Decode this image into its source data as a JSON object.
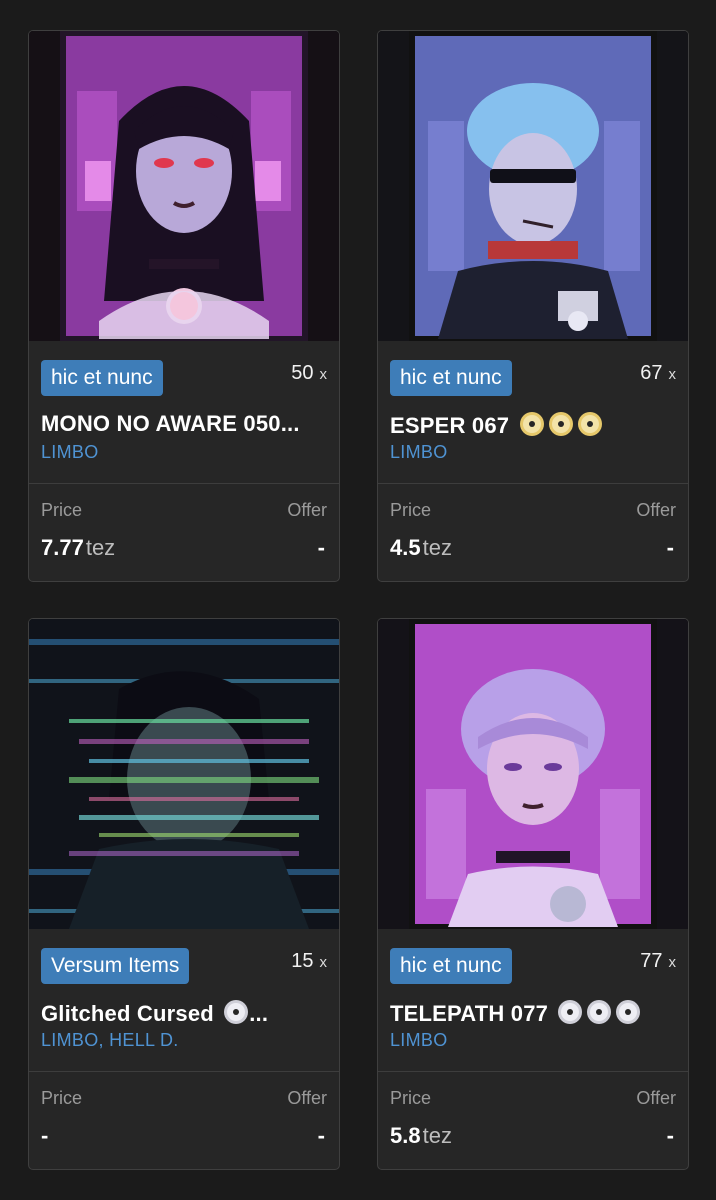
{
  "cards": [
    {
      "platform": "hic et nunc",
      "edition": "50",
      "edition_suffix": "x",
      "title": "MONO NO AWARE 050...",
      "artist": "LIMBO",
      "price_label": "Price",
      "offer_label": "Offer",
      "price": "7.77",
      "price_unit": "tez",
      "offer": "-"
    },
    {
      "platform": "hic et nunc",
      "edition": "67",
      "edition_suffix": "x",
      "title": "ESPER 067",
      "artist": "LIMBO",
      "price_label": "Price",
      "offer_label": "Offer",
      "price": "4.5",
      "price_unit": "tez",
      "offer": "-"
    },
    {
      "platform": "Versum Items",
      "edition": "15",
      "edition_suffix": "x",
      "title": "Glitched Cursed",
      "title_ellipsis": "...",
      "artist": "LIMBO, HELL D.",
      "price_label": "Price",
      "offer_label": "Offer",
      "price": "-",
      "price_unit": "",
      "offer": "-"
    },
    {
      "platform": "hic et nunc",
      "edition": "77",
      "edition_suffix": "x",
      "title": "TELEPATH 077",
      "artist": "LIMBO",
      "price_label": "Price",
      "offer_label": "Offer",
      "price": "5.8",
      "price_unit": "tez",
      "offer": "-"
    }
  ],
  "colors": {
    "background": "#1b1b1b",
    "card": "#262626",
    "badge": "#3e7db8",
    "artist_link": "#4f93d3"
  },
  "icons": {
    "title_emoji": "optical-disc-icon"
  }
}
